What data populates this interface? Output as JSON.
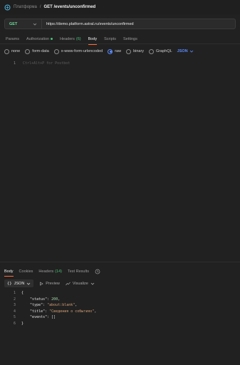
{
  "header": {
    "parent": "Платформа",
    "separator": "/",
    "title": "GET /events/unconfirmed",
    "logo_icon": "api-request-icon"
  },
  "request": {
    "method": "GET",
    "method_color": "#6bdd9a",
    "url": "https://demo.platform.astral.ru/events/unconfirmed"
  },
  "request_tabs": [
    {
      "label": "Params"
    },
    {
      "label": "Authorization"
    },
    {
      "label": "Headers",
      "count": "(6)"
    },
    {
      "label": "Body"
    },
    {
      "label": "Scripts"
    },
    {
      "label": "Settings"
    }
  ],
  "active_request_tab": "Body",
  "body_types": [
    "none",
    "form-data",
    "x-www-form-urlencoded",
    "raw",
    "binary",
    "GraphQL"
  ],
  "selected_body_type": "raw",
  "body_language": "JSON",
  "editor": {
    "line_number": "1",
    "placeholder": "Ctrl+Alt+P for Postbot"
  },
  "response_tabs": {
    "body": "Body",
    "cookies": "Cookies",
    "headers": "Headers",
    "headers_count": "(14)",
    "test_results": "Test Results"
  },
  "response_toolbar": {
    "format": "JSON",
    "preview": "Preview",
    "visualize": "Visualize"
  },
  "response_lines": [
    {
      "n": "1",
      "text": "{"
    },
    {
      "n": "2",
      "key": "\"status\"",
      "sep": ": ",
      "num": "200",
      "end": ","
    },
    {
      "n": "3",
      "key": "\"type\"",
      "sep": ": ",
      "str": "\"about:blank\"",
      "end": ","
    },
    {
      "n": "4",
      "key": "\"title\"",
      "sep": ": ",
      "str": "\"Сведения о событиях\"",
      "end": ","
    },
    {
      "n": "5",
      "key": "\"events\"",
      "sep": ": ",
      "text2": "[]"
    },
    {
      "n": "6",
      "text": "}"
    }
  ],
  "colors": {
    "accent": "#ff6c37",
    "link_blue": "#5b8cff",
    "success_green": "#49c07a",
    "background": "#212121"
  }
}
